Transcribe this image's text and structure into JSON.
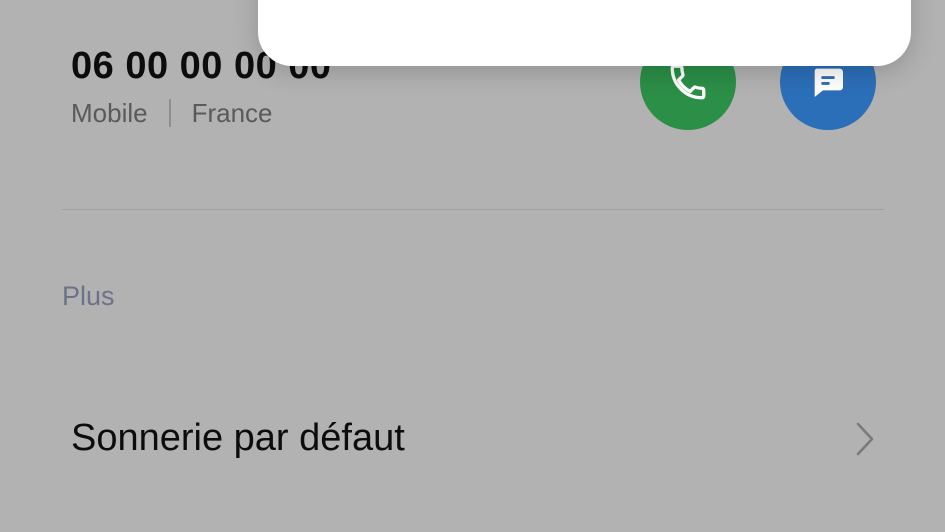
{
  "contact": {
    "phone_number": "06 00 00 00 00",
    "number_type": "Mobile",
    "country": "France"
  },
  "actions": {
    "call_icon": "phone-icon",
    "message_icon": "message-icon",
    "call_color": "#2b8f47",
    "message_color": "#2c6fb9"
  },
  "more_section": {
    "title": "Plus",
    "ringtone_label": "Sonnerie par défaut",
    "chevron_icon": "chevron-right-icon"
  }
}
